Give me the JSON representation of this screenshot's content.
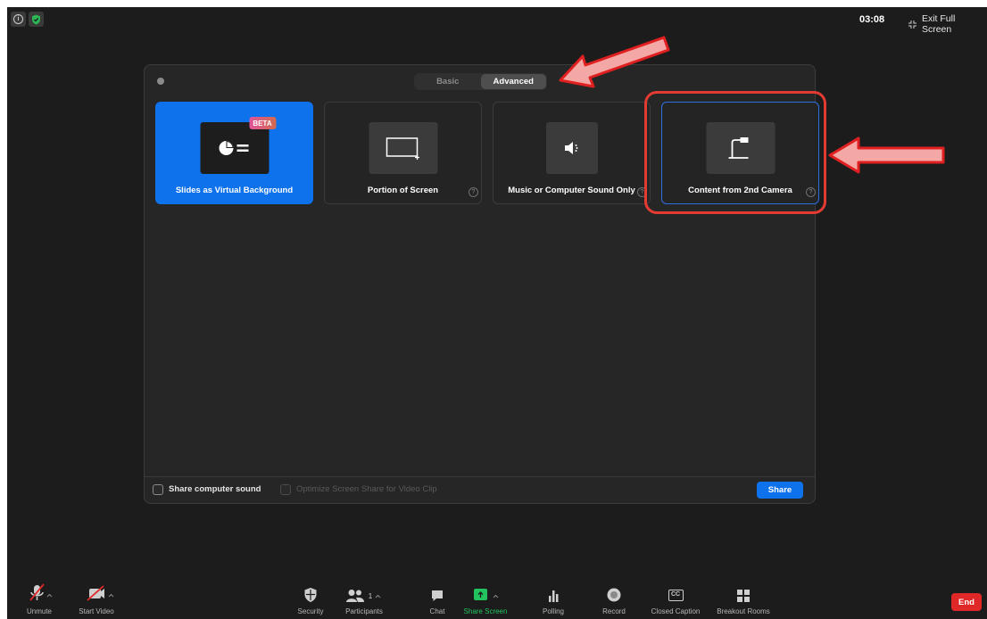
{
  "top_bar": {
    "time": "03:08",
    "exit_full_screen": "Exit Full Screen"
  },
  "dialog": {
    "tabs": [
      {
        "label": "Basic",
        "active": false
      },
      {
        "label": "Advanced",
        "active": true
      }
    ],
    "cards": [
      {
        "label": "Slides as Virtual Background",
        "badge": "BETA",
        "icon": "pie-slides-icon",
        "selected": true
      },
      {
        "label": "Portion of Screen",
        "icon": "screen-portion-icon"
      },
      {
        "label": "Music or Computer Sound Only",
        "icon": "speaker-icon"
      },
      {
        "label": "Content from 2nd Camera",
        "icon": "document-camera-icon"
      }
    ],
    "footer": {
      "share_sound_label": "Share computer sound",
      "optimize_label": "Optimize Screen Share for Video Clip",
      "share_button": "Share"
    }
  },
  "toolbar": {
    "items": [
      {
        "label": "Unmute",
        "icon": "mic-muted-icon"
      },
      {
        "label": "Start Video",
        "icon": "video-off-icon"
      },
      {
        "label": "Security",
        "icon": "shield-icon"
      },
      {
        "label": "Participants",
        "icon": "participants-icon",
        "count": "1"
      },
      {
        "label": "Chat",
        "icon": "chat-icon"
      },
      {
        "label": "Share Screen",
        "icon": "share-screen-icon"
      },
      {
        "label": "Polling",
        "icon": "polling-icon"
      },
      {
        "label": "Record",
        "icon": "record-icon"
      },
      {
        "label": "Closed Caption",
        "icon": "cc-icon",
        "icon_text": "CC"
      },
      {
        "label": "Breakout Rooms",
        "icon": "breakout-rooms-icon"
      }
    ],
    "end_button": "End"
  },
  "colors": {
    "accent": "#0e72ed",
    "annotation": "#e33a32",
    "share_green": "#22c35e",
    "end_red": "#e02828"
  }
}
